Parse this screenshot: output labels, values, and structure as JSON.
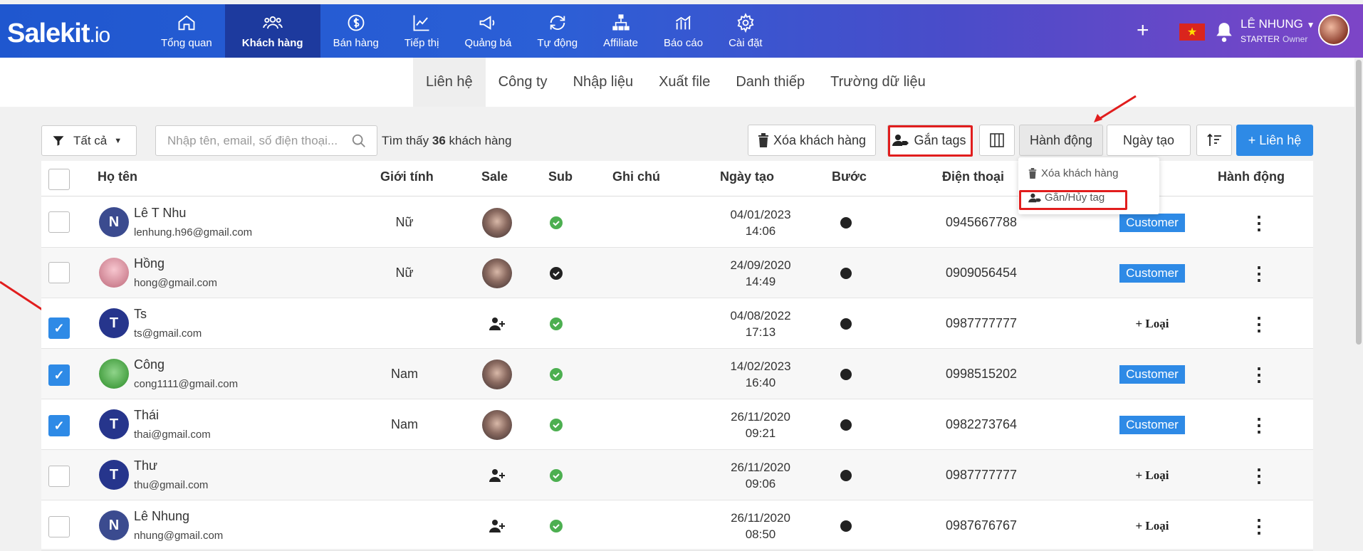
{
  "app": {
    "brand_main": "Salekit",
    "brand_ext": ".io"
  },
  "nav": {
    "items": [
      {
        "label": "Tổng quan",
        "icon": "home-icon"
      },
      {
        "label": "Khách hàng",
        "icon": "users-icon",
        "active": true
      },
      {
        "label": "Bán hàng",
        "icon": "dollar-icon"
      },
      {
        "label": "Tiếp thị",
        "icon": "chart-line-icon"
      },
      {
        "label": "Quảng bá",
        "icon": "megaphone-icon"
      },
      {
        "label": "Tự động",
        "icon": "refresh-icon"
      },
      {
        "label": "Affiliate",
        "icon": "sitemap-icon"
      },
      {
        "label": "Báo cáo",
        "icon": "bar-chart-icon"
      },
      {
        "label": "Cài đặt",
        "icon": "gear-icon"
      }
    ],
    "plus": "+",
    "user_name": "LÊ NHUNG",
    "user_plan": "STARTER",
    "user_role": "Owner"
  },
  "subtabs": [
    "Liên hệ",
    "Công ty",
    "Nhập liệu",
    "Xuất file",
    "Danh thiếp",
    "Trường dữ liệu"
  ],
  "toolbar": {
    "filter_label": "Tất cả",
    "search_placeholder": "Nhập tên, email, số điện thoại...",
    "found_prefix": "Tìm thấy",
    "found_count": "36",
    "found_suffix": "khách hàng",
    "delete_label": "Xóa khách hàng",
    "tag_label": "Gắn tags",
    "action_label": "Hành động",
    "date_label": "Ngày tạo",
    "add_label": "+ Liên hệ"
  },
  "action_menu": {
    "delete": "Xóa khách hàng",
    "tag": "Gắn/Hủy tag"
  },
  "table": {
    "headers": [
      "Họ tên",
      "Giới tính",
      "Sale",
      "Sub",
      "Ghi chú",
      "Ngày tạo",
      "Bước",
      "Điện thoại",
      "Hành động"
    ],
    "rows": [
      {
        "name": "Lê T Nhu",
        "email": "lenhung.h96@gmail.com",
        "avatar": "N",
        "gender": "Nữ",
        "sale": "avatar",
        "sub": "green",
        "date": "04/01/2023",
        "time": "14:06",
        "phone": "0945667788",
        "tag": "Customer",
        "checked": false
      },
      {
        "name": "Hồng",
        "email": "hong@gmail.com",
        "avatar": "img",
        "gender": "Nữ",
        "sale": "avatar",
        "sub": "dark",
        "date": "24/09/2020",
        "time": "14:49",
        "phone": "0909056454",
        "tag": "Customer",
        "checked": false
      },
      {
        "name": "Ts",
        "email": "ts@gmail.com",
        "avatar": "T",
        "gender": "",
        "sale": "add",
        "sub": "green",
        "date": "04/08/2022",
        "time": "17:13",
        "phone": "0987777777",
        "tag": "+ Loại",
        "checked": true
      },
      {
        "name": "Công",
        "email": "cong1111@gmail.com",
        "avatar": "img",
        "gender": "Nam",
        "sale": "avatar",
        "sub": "green",
        "date": "14/02/2023",
        "time": "16:40",
        "phone": "0998515202",
        "tag": "Customer",
        "checked": true
      },
      {
        "name": "Thái",
        "email": "thai@gmail.com",
        "avatar": "T",
        "gender": "Nam",
        "sale": "avatar",
        "sub": "green",
        "date": "26/11/2020",
        "time": "09:21",
        "phone": "0982273764",
        "tag": "Customer",
        "checked": true
      },
      {
        "name": "Thư",
        "email": "thu@gmail.com",
        "avatar": "T",
        "gender": "",
        "sale": "add",
        "sub": "green",
        "date": "26/11/2020",
        "time": "09:06",
        "phone": "0987777777",
        "tag": "+ Loại",
        "checked": false
      },
      {
        "name": "Lê Nhung",
        "email": "nhung@gmail.com",
        "avatar": "N",
        "gender": "",
        "sale": "add",
        "sub": "green",
        "date": "26/11/2020",
        "time": "08:50",
        "phone": "0987676767",
        "tag": "+ Loại",
        "checked": false
      }
    ]
  },
  "colors": {
    "primary": "#2e8ae6",
    "nav_start": "#1f57cf",
    "nav_end": "#7d45c7",
    "success": "#4caf50",
    "highlight": "#e11d1d"
  }
}
